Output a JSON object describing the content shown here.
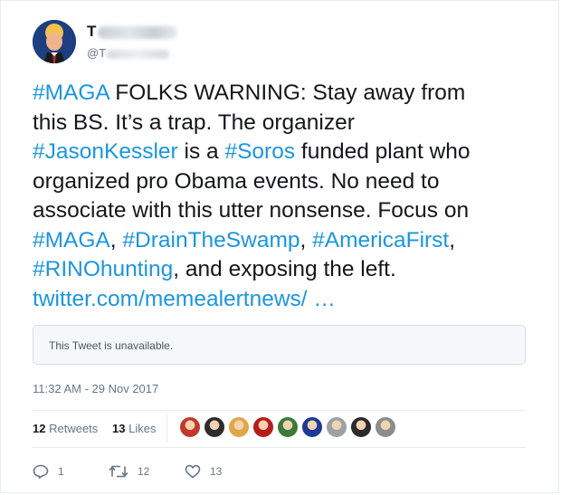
{
  "user": {
    "display_name_initial": "T",
    "handle_prefix": "@T"
  },
  "tweet": {
    "lines": [
      [
        {
          "t": "#MAGA",
          "type": "hashtag"
        },
        {
          "t": " FOLKS WARNING: Stay away from",
          "type": "text"
        }
      ],
      [
        {
          "t": "this BS. It’s a trap. The organizer",
          "type": "text"
        }
      ],
      [
        {
          "t": "#JasonKessler",
          "type": "hashtag"
        },
        {
          "t": " is a ",
          "type": "text"
        },
        {
          "t": "#Soros",
          "type": "hashtag"
        },
        {
          "t": " funded plant who",
          "type": "text"
        }
      ],
      [
        {
          "t": "organized pro Obama events. No need to",
          "type": "text"
        }
      ],
      [
        {
          "t": "associate with this utter nonsense. Focus on",
          "type": "text"
        }
      ],
      [
        {
          "t": "#MAGA",
          "type": "hashtag"
        },
        {
          "t": ", ",
          "type": "text"
        },
        {
          "t": "#DrainTheSwamp",
          "type": "hashtag"
        },
        {
          "t": ", ",
          "type": "text"
        },
        {
          "t": "#AmericaFirst",
          "type": "hashtag"
        },
        {
          "t": ",",
          "type": "text"
        }
      ],
      [
        {
          "t": "#RINOhunting",
          "type": "hashtag"
        },
        {
          "t": ", and exposing the left.",
          "type": "text"
        }
      ],
      [
        {
          "t": "twitter.com/memealertnews/ …",
          "type": "link"
        }
      ]
    ]
  },
  "quoted": {
    "unavailable_text": "This Tweet is unavailable."
  },
  "timestamp": "11:32 AM - 29 Nov 2017",
  "stats": {
    "retweets_count": "12",
    "retweets_label": "Retweets",
    "likes_count": "13",
    "likes_label": "Likes"
  },
  "actions": {
    "reply_count": "1",
    "retweet_count": "12",
    "like_count": "13"
  },
  "colors": {
    "link": "#1b95e0",
    "text": "#14171a",
    "muted": "#657786"
  },
  "liker_avatar_colors": [
    "#c0392b",
    "#2c2c2c",
    "#e0a64a",
    "#b71c1c",
    "#3d7a3a",
    "#1f3a93",
    "#9aa2a8",
    "#2b2b2b",
    "#8c8c8c"
  ]
}
